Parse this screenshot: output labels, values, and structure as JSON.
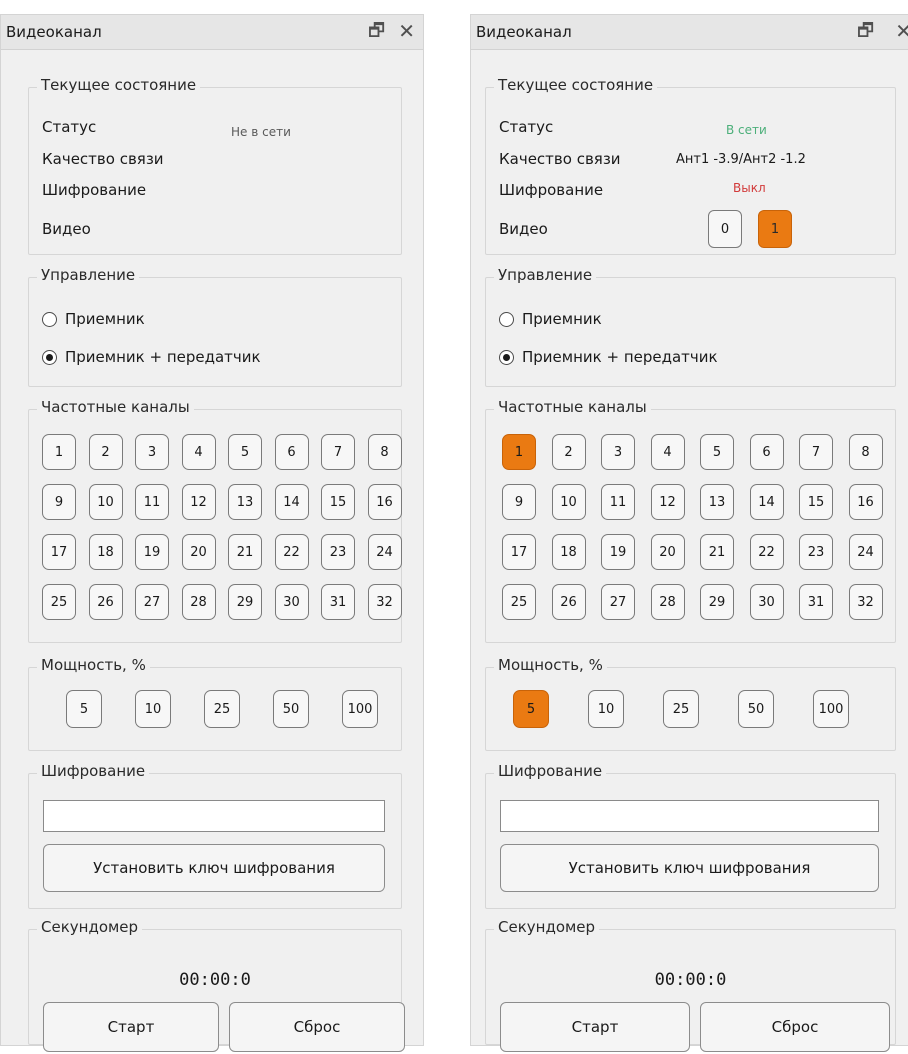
{
  "panels": [
    {
      "title": "Видеоканал",
      "status_group": {
        "label": "Текущее состояние",
        "status_label": "Статус",
        "status_value": "Не в сети",
        "quality_label": "Качество связи",
        "quality_value": "",
        "encryption_label": "Шифрование",
        "encryption_value": "",
        "video_label": "Видео",
        "video_buttons": []
      },
      "control_group": {
        "label": "Управление",
        "option1": "Приемник",
        "option2": "Приемник + передатчик",
        "selected": "option2"
      },
      "freq_group": {
        "label": "Частотные каналы",
        "channels": [
          "1",
          "2",
          "3",
          "4",
          "5",
          "6",
          "7",
          "8",
          "9",
          "10",
          "11",
          "12",
          "13",
          "14",
          "15",
          "16",
          "17",
          "18",
          "19",
          "20",
          "21",
          "22",
          "23",
          "24",
          "25",
          "26",
          "27",
          "28",
          "29",
          "30",
          "31",
          "32"
        ],
        "active": null
      },
      "power_group": {
        "label": "Мощность, %",
        "values": [
          "5",
          "10",
          "25",
          "50",
          "100"
        ],
        "active": null
      },
      "crypt_group": {
        "label": "Шифрование",
        "key_value": "",
        "set_key_button": "Установить ключ шифрования"
      },
      "timer_group": {
        "label": "Секундомер",
        "time": "00:00:0",
        "start_button": "Старт",
        "reset_button": "Сброс"
      }
    },
    {
      "title": "Видеоканал",
      "status_group": {
        "label": "Текущее состояние",
        "status_label": "Статус",
        "status_value": "В сети",
        "quality_label": "Качество связи",
        "quality_value": "Ант1 -3.9/Ант2 -1.2",
        "encryption_label": "Шифрование",
        "encryption_value": "Выкл",
        "video_label": "Видео",
        "video_buttons": [
          "0",
          "1"
        ],
        "video_active": "1"
      },
      "control_group": {
        "label": "Управление",
        "option1": "Приемник",
        "option2": "Приемник + передатчик",
        "selected": "option2"
      },
      "freq_group": {
        "label": "Частотные каналы",
        "channels": [
          "1",
          "2",
          "3",
          "4",
          "5",
          "6",
          "7",
          "8",
          "9",
          "10",
          "11",
          "12",
          "13",
          "14",
          "15",
          "16",
          "17",
          "18",
          "19",
          "20",
          "21",
          "22",
          "23",
          "24",
          "25",
          "26",
          "27",
          "28",
          "29",
          "30",
          "31",
          "32"
        ],
        "active": "1"
      },
      "power_group": {
        "label": "Мощность, %",
        "values": [
          "5",
          "10",
          "25",
          "50",
          "100"
        ],
        "active": "5"
      },
      "crypt_group": {
        "label": "Шифрование",
        "key_value": "",
        "set_key_button": "Установить ключ шифрования"
      },
      "timer_group": {
        "label": "Секундомер",
        "time": "00:00:0",
        "start_button": "Старт",
        "reset_button": "Сброс"
      }
    }
  ],
  "icons": {
    "float": "float-window-icon",
    "close": "close-icon"
  },
  "colors": {
    "active_orange": "#ea7a12",
    "online_green": "#4caf7a",
    "off_red": "#d23a3a",
    "offline_gray": "#5a5a5a"
  }
}
